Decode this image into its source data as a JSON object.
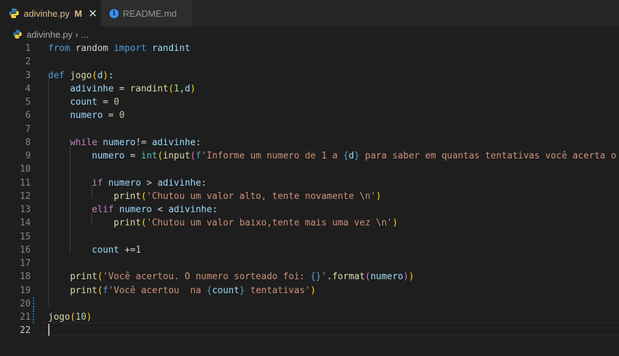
{
  "tabs": [
    {
      "label": "adivinhe.py",
      "status": "M",
      "active": true
    },
    {
      "label": "README.md",
      "active": false
    }
  ],
  "breadcrumb": {
    "file": "adivinhe.py",
    "separator": "›",
    "more": "..."
  },
  "icons": {
    "python": "python-file-icon",
    "info": "info-icon",
    "close": "close-icon"
  },
  "colors": {
    "keyword": "#569cd6",
    "control": "#c586c0",
    "function": "#dcdcaa",
    "variable": "#9cdcfe",
    "string": "#ce9178",
    "number": "#b5cea8",
    "class": "#4ec9b0",
    "bracket1": "#ffd700",
    "bracket2": "#da70d6",
    "bracket3": "#179fff"
  },
  "editor": {
    "current_line": 22,
    "lines": [
      [
        [
          "kw",
          "from"
        ],
        [
          "pl",
          " random "
        ],
        [
          "kw",
          "import"
        ],
        [
          "pl",
          " "
        ],
        [
          "var",
          "randint"
        ]
      ],
      [],
      [
        [
          "kw",
          "def"
        ],
        [
          "pl",
          " "
        ],
        [
          "fn",
          "jogo"
        ],
        [
          "br1",
          "("
        ],
        [
          "var",
          "d"
        ],
        [
          "br1",
          ")"
        ],
        [
          "pl",
          ":"
        ]
      ],
      [
        [
          "pl",
          "    "
        ],
        [
          "var",
          "adivinhe"
        ],
        [
          "pl",
          " = "
        ],
        [
          "fn",
          "randint"
        ],
        [
          "br1",
          "("
        ],
        [
          "num",
          "1"
        ],
        [
          "pl",
          ","
        ],
        [
          "var",
          "d"
        ],
        [
          "br1",
          ")"
        ]
      ],
      [
        [
          "pl",
          "    "
        ],
        [
          "var",
          "count"
        ],
        [
          "pl",
          " = "
        ],
        [
          "num",
          "0"
        ]
      ],
      [
        [
          "pl",
          "    "
        ],
        [
          "var",
          "numero"
        ],
        [
          "pl",
          " = "
        ],
        [
          "num",
          "0"
        ]
      ],
      [],
      [
        [
          "pl",
          "    "
        ],
        [
          "ctrl",
          "while"
        ],
        [
          "pl",
          " "
        ],
        [
          "var",
          "numero"
        ],
        [
          "pl",
          "!= "
        ],
        [
          "var",
          "adivinhe"
        ],
        [
          "pl",
          ":"
        ]
      ],
      [
        [
          "pl",
          "        "
        ],
        [
          "var",
          "numero"
        ],
        [
          "pl",
          " = "
        ],
        [
          "type",
          "int"
        ],
        [
          "br1",
          "("
        ],
        [
          "fn",
          "input"
        ],
        [
          "br2",
          "("
        ],
        [
          "kw",
          "f"
        ],
        [
          "str",
          "'Informe um numero de 1 a "
        ],
        [
          "kw",
          "{"
        ],
        [
          "var",
          "d"
        ],
        [
          "kw",
          "}"
        ],
        [
          "str",
          " para saber em quantas tentativas você acerta o "
        ]
      ],
      [],
      [
        [
          "pl",
          "        "
        ],
        [
          "ctrl",
          "if"
        ],
        [
          "pl",
          " "
        ],
        [
          "var",
          "numero"
        ],
        [
          "pl",
          " > "
        ],
        [
          "var",
          "adivinhe"
        ],
        [
          "pl",
          ":"
        ]
      ],
      [
        [
          "pl",
          "            "
        ],
        [
          "fn",
          "print"
        ],
        [
          "br1",
          "("
        ],
        [
          "str",
          "'Chutou um valor alto, tente novamente "
        ],
        [
          "str",
          "\\n"
        ],
        [
          "str",
          "'"
        ],
        [
          "br1",
          ")"
        ]
      ],
      [
        [
          "pl",
          "        "
        ],
        [
          "ctrl",
          "elif"
        ],
        [
          "pl",
          " "
        ],
        [
          "var",
          "numero"
        ],
        [
          "pl",
          " < "
        ],
        [
          "var",
          "adivinhe"
        ],
        [
          "pl",
          ":"
        ]
      ],
      [
        [
          "pl",
          "            "
        ],
        [
          "fn",
          "print"
        ],
        [
          "br1",
          "("
        ],
        [
          "str",
          "'Chutou um valor baixo,tente mais uma vez "
        ],
        [
          "str",
          "\\n"
        ],
        [
          "str",
          "'"
        ],
        [
          "br1",
          ")"
        ]
      ],
      [],
      [
        [
          "pl",
          "        "
        ],
        [
          "var",
          "count"
        ],
        [
          "pl",
          " +="
        ],
        [
          "num",
          "1"
        ]
      ],
      [],
      [
        [
          "pl",
          "    "
        ],
        [
          "fn",
          "print"
        ],
        [
          "br1",
          "("
        ],
        [
          "str",
          "'Você acertou. O numero sorteado foi: "
        ],
        [
          "kw",
          "{}"
        ],
        [
          "str",
          "'"
        ],
        [
          "pl",
          "."
        ],
        [
          "fn",
          "format"
        ],
        [
          "br2",
          "("
        ],
        [
          "var",
          "numero"
        ],
        [
          "br2",
          ")"
        ],
        [
          "br1",
          ")"
        ]
      ],
      [
        [
          "pl",
          "    "
        ],
        [
          "fn",
          "print"
        ],
        [
          "br1",
          "("
        ],
        [
          "kw",
          "f"
        ],
        [
          "str",
          "'Você acertou  na "
        ],
        [
          "kw",
          "{"
        ],
        [
          "var",
          "count"
        ],
        [
          "kw",
          "}"
        ],
        [
          "str",
          " tentativas'"
        ],
        [
          "br1",
          ")"
        ]
      ],
      [],
      [
        [
          "fn",
          "jogo"
        ],
        [
          "br1",
          "("
        ],
        [
          "num",
          "10"
        ],
        [
          "br1",
          ")"
        ]
      ],
      []
    ]
  }
}
